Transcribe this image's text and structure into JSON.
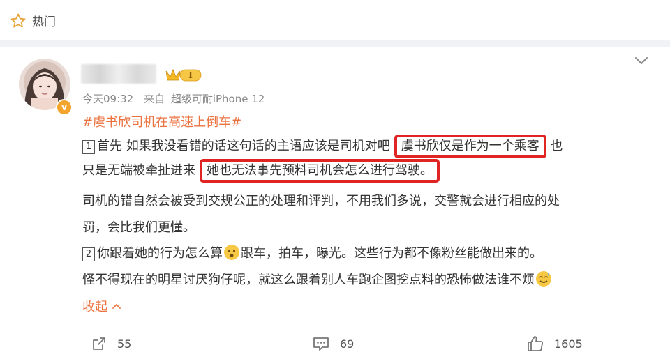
{
  "header": {
    "title": "热门",
    "icon": "star-outline-icon"
  },
  "post": {
    "time": "今天09:32",
    "source_prefix": "来自",
    "source": "超级可耐iPhone 12",
    "vip_level": "I",
    "topic": "#虞书欣司机在高速上倒车#",
    "p1_num": "1",
    "p1_a": "首先 如果我没看错的话这句话的主语应该是司机对吧",
    "p1_hl1": "虞书欣仅是作为一个乘客",
    "p1_b": "也",
    "p2_a": "只是无端被牵扯进来",
    "p2_hl2": "她也无法事先预料司机会怎么进行驾驶。",
    "p3": "司机的错自然会被受到交规公正的处理和评判，不用我们多说，交警就会进行相应的处",
    "p4": "罚，会比我们更懂。",
    "p5_num": "2",
    "p5_a": "你跟着她的行为怎么算",
    "p5_b": "跟车，拍车，曝光。这些行为都不像粉丝能做出来的。",
    "p6": "怪不得现在的明星讨厌狗仔呢，就这么跟着别人车跑企图挖点料的恐怖做法谁不烦",
    "collapse_label": "收起"
  },
  "actions": {
    "share_count": "55",
    "comment_count": "69",
    "like_count": "1605"
  },
  "colors": {
    "accent": "#eb7340",
    "highlight_border": "#e02424"
  }
}
